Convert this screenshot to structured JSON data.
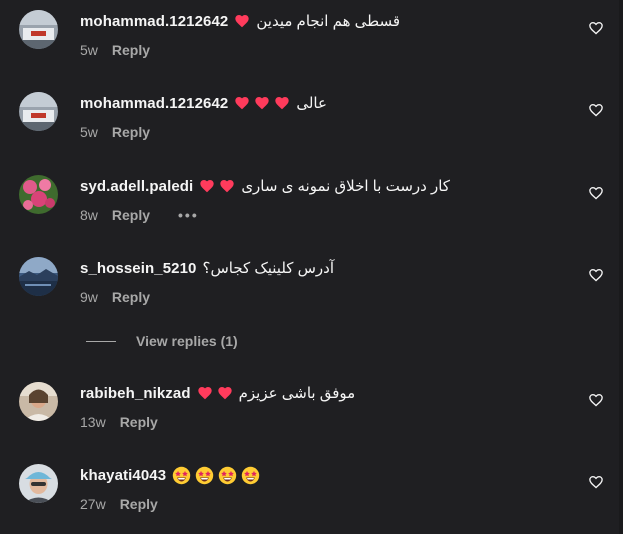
{
  "comments": [
    {
      "username": "mohammad.1212642",
      "text": "قسطی هم انجام میدین",
      "hearts": 1,
      "time": "5w",
      "reply_label": "Reply",
      "avatar": "car-photo-avatar"
    },
    {
      "username": "mohammad.1212642",
      "text": "عالی",
      "hearts": 3,
      "time": "5w",
      "reply_label": "Reply",
      "avatar": "car-photo-avatar"
    },
    {
      "username": "syd.adell.paledi",
      "text": "کار درست با اخلاق نمونه ی ساری",
      "hearts": 2,
      "time": "8w",
      "reply_label": "Reply",
      "more_label": "•••",
      "avatar": "flowers-avatar"
    },
    {
      "username": "s_hossein_5210",
      "text": "آدرس کلینیک کجاس؟",
      "time": "9w",
      "reply_label": "Reply",
      "avatar": "landscape-avatar"
    },
    {
      "username": "rabibeh_nikzad",
      "text": "موفق باشی عزیزم",
      "hearts": 2,
      "time": "13w",
      "reply_label": "Reply",
      "avatar": "portrait-avatar"
    },
    {
      "username": "khayati4043",
      "emoji": "star-struck",
      "emoji_count": 4,
      "time": "27w",
      "reply_label": "Reply",
      "avatar": "cap-portrait-avatar"
    }
  ],
  "view_replies_label": "View replies (1)",
  "colors": {
    "background": "#1f1f22",
    "text": "#f5f5f5",
    "muted": "#a8a8a8",
    "heart": "#ff3b5c"
  }
}
